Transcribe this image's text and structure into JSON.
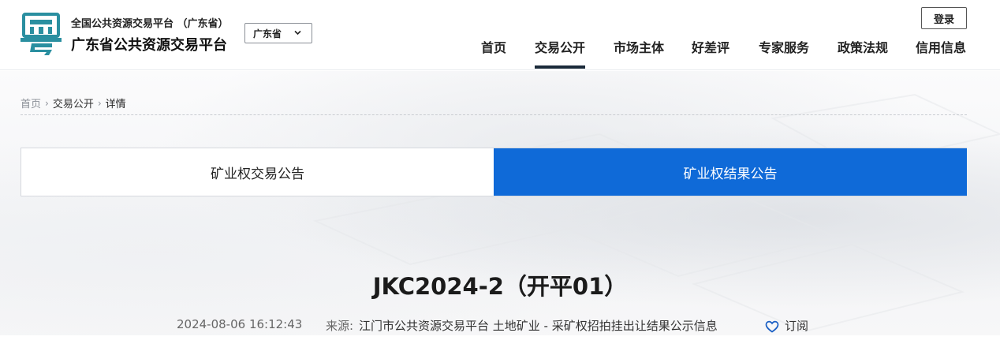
{
  "header": {
    "brand_sub": "全国公共资源交易平台 （广东省）",
    "brand_main": "广东省公共资源交易平台",
    "region": "广东省",
    "login_label": "登录",
    "nav": [
      {
        "label": "首页"
      },
      {
        "label": "交易公开"
      },
      {
        "label": "市场主体"
      },
      {
        "label": "好差评"
      },
      {
        "label": "专家服务"
      },
      {
        "label": "政策法规"
      },
      {
        "label": "信用信息"
      }
    ],
    "active_nav": "交易公开"
  },
  "breadcrumb": {
    "home": "首页",
    "section": "交易公开",
    "current": "详情"
  },
  "tabs": [
    {
      "label": "矿业权交易公告",
      "active": false
    },
    {
      "label": "矿业权结果公告",
      "active": true
    }
  ],
  "article": {
    "title": "JKC2024-2（开平01）",
    "time": "2024-08-06 16:12:43",
    "source_label": "来源:",
    "source_value": "江门市公共资源交易平台 土地矿业 - 采矿权招拍挂出让结果公示信息",
    "subscribe_label": "订阅"
  },
  "colors": {
    "accent": "#0f6ad8",
    "logo_teal": "#2a8fa0",
    "nav_underline": "#1a2a3a"
  },
  "icons": [
    "logo-icon",
    "chevron-down-icon",
    "heart-icon"
  ]
}
